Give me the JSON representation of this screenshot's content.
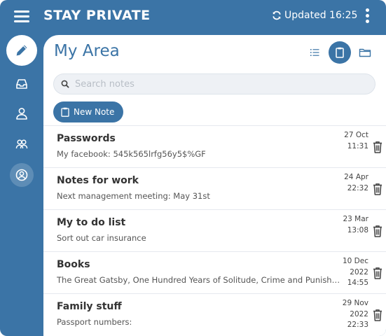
{
  "app": {
    "brand": "STAY PRIVATE",
    "updated": "Updated 16:25"
  },
  "sidebar": {
    "items": [
      {
        "name": "sidebar-item-notes",
        "icon": "pencil-icon"
      },
      {
        "name": "sidebar-item-inbox",
        "icon": "inbox-icon"
      },
      {
        "name": "sidebar-item-profile",
        "icon": "user-icon"
      },
      {
        "name": "sidebar-item-contacts",
        "icon": "group-icon"
      },
      {
        "name": "sidebar-item-account",
        "icon": "user-circle-icon"
      }
    ]
  },
  "main": {
    "title": "My Area",
    "views": [
      "list-icon",
      "clipboard-icon",
      "folder-icon"
    ],
    "search_placeholder": "Search notes",
    "new_note_label": "New Note"
  },
  "notes": [
    {
      "title": "Passwords",
      "preview": "My facebook: 545k565lrfg56y5$%GF",
      "date_line1": "27 Oct",
      "date_line2": "11:31",
      "date_line3": ""
    },
    {
      "title": "Notes for work",
      "preview": "Next management meeting: May 31st",
      "date_line1": "24 Apr",
      "date_line2": "22:32",
      "date_line3": ""
    },
    {
      "title": "My to do list",
      "preview": "Sort out car insurance",
      "date_line1": "23 Mar",
      "date_line2": "13:08",
      "date_line3": ""
    },
    {
      "title": "Books",
      "preview": "The Great Gatsby, One Hundred Years of Solitude, Crime and Punishment",
      "date_line1": "10 Dec",
      "date_line2": "2022",
      "date_line3": "14:55"
    },
    {
      "title": "Family stuff",
      "preview": "Passport numbers:",
      "date_line1": "29 Nov",
      "date_line2": "2022",
      "date_line3": "22:33"
    }
  ],
  "colors": {
    "accent": "#3b74a6",
    "background": "#ffffff",
    "text": "#333333"
  }
}
